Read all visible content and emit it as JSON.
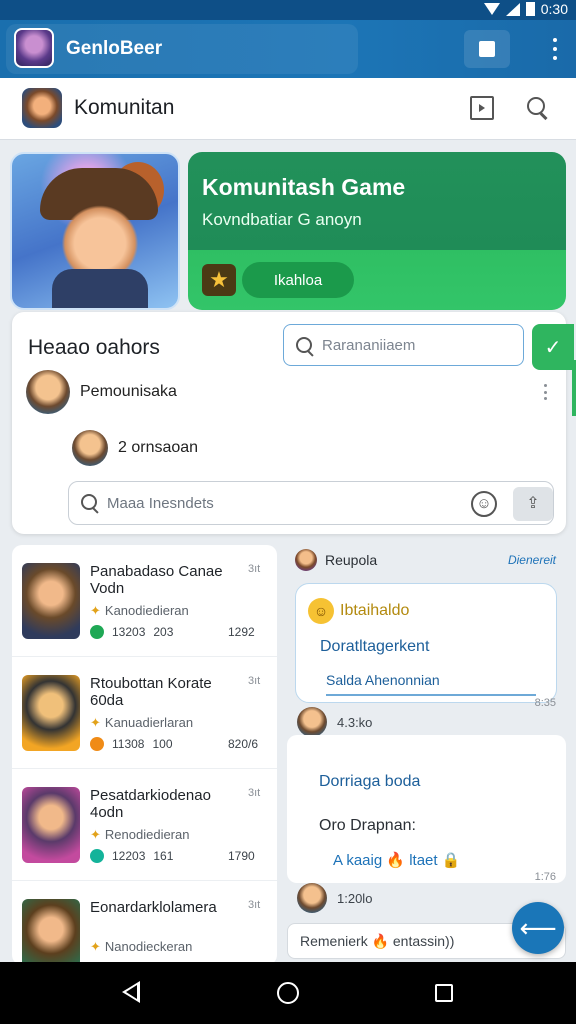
{
  "status_bar": {
    "time": "0:30"
  },
  "app_bar": {
    "title": "GenloBeer"
  },
  "header": {
    "title": "Komunitan"
  },
  "hero": {
    "title": "Komunitash Game",
    "subtitle": "Kovndbatiar G anoyn",
    "join_label": "Ikahloa"
  },
  "community": {
    "title": "Heaao oahors",
    "search_placeholder": "Rarananiiaem",
    "members": [
      {
        "name": "Pemounisaka"
      },
      {
        "name": "2 ornsaoan"
      }
    ],
    "message_placeholder": "Maaa Inesndets"
  },
  "games": [
    {
      "name": "Panabadaso Canae Vodn",
      "count": "3ıt",
      "developer": "Kanodiedieran",
      "stat_a": "13203",
      "stat_b": "203",
      "date": "1292",
      "dot_color": "#1fa855"
    },
    {
      "name": "Rtoubottan Korate 60da",
      "count": "3ıt",
      "developer": "Kanuadierlaran",
      "stat_a": "11308",
      "stat_b": "100",
      "date": "820/6",
      "dot_color": "#f08b16"
    },
    {
      "name": "Pesatdarkiodenao 4odn",
      "count": "3ıt",
      "developer": "Renodiedieran",
      "stat_a": "12203",
      "stat_b": "161",
      "date": "1790",
      "dot_color": "#14b39a"
    },
    {
      "name": "Eonardarklolamera",
      "count": "3ıt",
      "developer": "Nanodieckeran",
      "stat_a": "",
      "stat_b": "",
      "date": "",
      "dot_color": "#1fa855"
    }
  ],
  "chat": {
    "head_name": "Reupola",
    "head_link": "Dienereit",
    "bubble1": {
      "line1": "Ibtaihaldo",
      "line2": "Doratltagerkent",
      "line3": "Salda Ahenonnian",
      "time": "8:35"
    },
    "row1_time": "4.3:ko",
    "bubble2": {
      "line1": "Dorriaga boda",
      "line2": "Oro Drapnan:",
      "line3": "A kaaig 🔥 ltaet 🔒",
      "time": "1:76"
    },
    "row2_time": "1:20lo",
    "input_text": "Remenierk 🔥 entassin))"
  },
  "colors": {
    "app_bar": "#1c75b6",
    "accent_green": "#2fb55f",
    "link_blue": "#1d72b8"
  }
}
